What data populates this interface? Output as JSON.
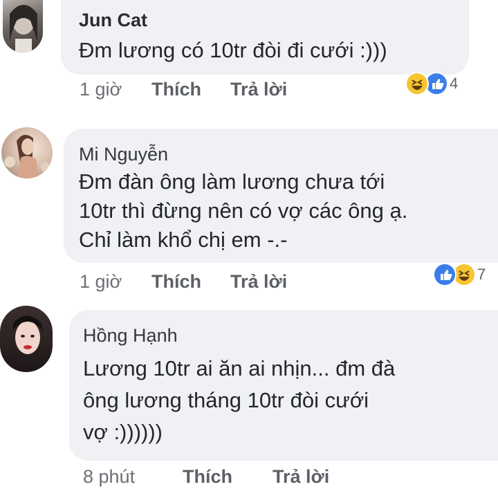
{
  "comments": [
    {
      "author": "Jun Cat",
      "lines": [
        "Đm lương có 10tr đòi đi cưới :)))"
      ],
      "time": "1 giờ",
      "like_label": "Thích",
      "reply_label": "Trả lời",
      "reactions": [
        "haha",
        "like"
      ],
      "reaction_count": "4"
    },
    {
      "author": "Mi Nguyễn",
      "lines": [
        "Đm đàn ông làm lương chưa tới",
        "10tr thì đừng nên có vợ các ông ạ.",
        "Chỉ làm khổ chị em -.-"
      ],
      "time": "1 giờ",
      "like_label": "Thích",
      "reply_label": "Trả lời",
      "reactions": [
        "like",
        "haha"
      ],
      "reaction_count": "7"
    },
    {
      "author": "Hồng Hạnh",
      "lines": [
        "Lương 10tr ai ăn ai nhịn... đm đà",
        "ông lương tháng 10tr đòi cưới",
        "vợ :))))))"
      ],
      "time": "8 phút",
      "like_label": "Thích",
      "reply_label": "Trả lời",
      "reactions": [],
      "reaction_count": ""
    }
  ],
  "colors": {
    "bubble": "#eff1f4",
    "like_blue": "#3b7de9",
    "haha_yellow": "#f7c532",
    "meta_gray": "#6b6f76"
  }
}
